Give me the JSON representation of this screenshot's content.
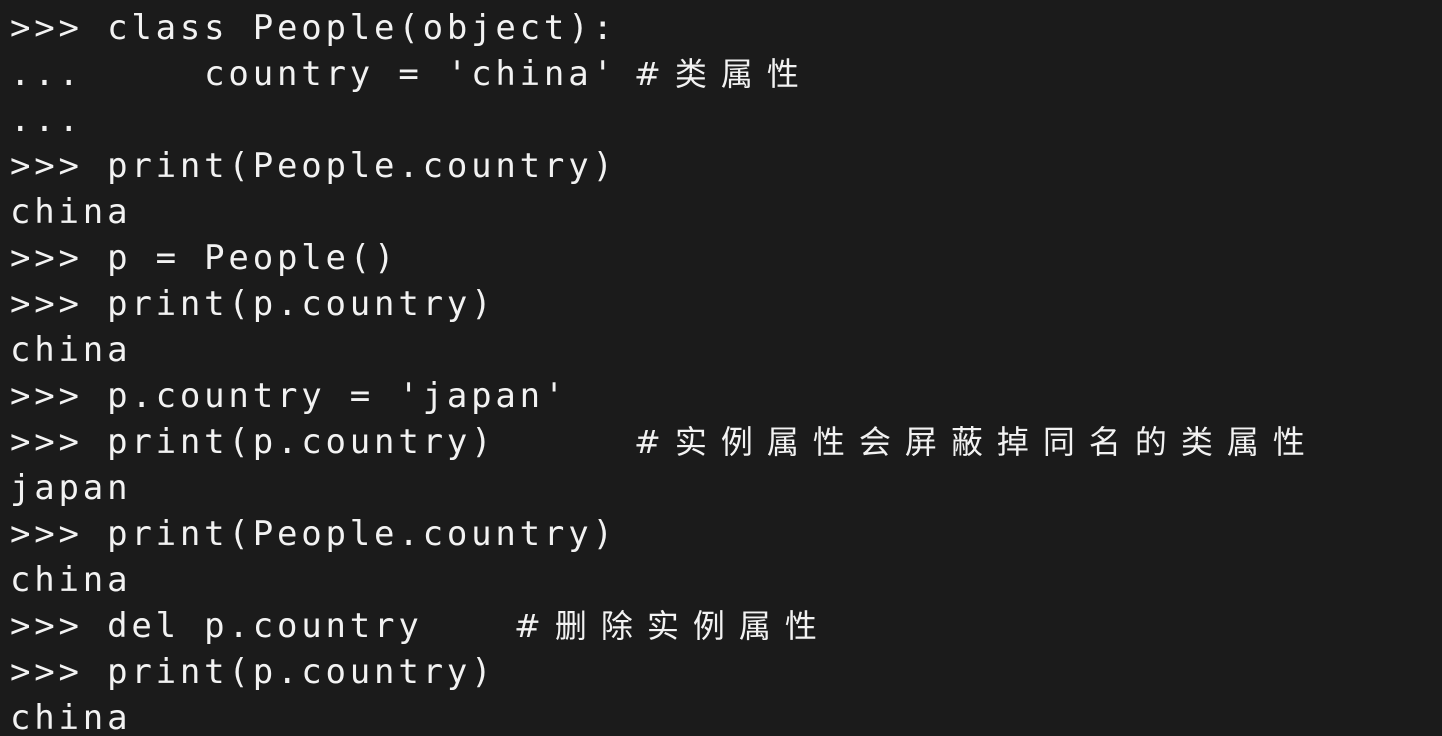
{
  "terminal": {
    "lines": [
      ">>> class People(object):",
      "...     country = 'china'",
      "...",
      ">>> print(People.country)",
      "china",
      ">>> p = People()",
      ">>> print(p.country)",
      "china",
      ">>> p.country = 'japan'",
      ">>> print(p.country)",
      "japan",
      ">>> print(People.country)",
      "china",
      ">>> del p.country",
      ">>> print(p.country)",
      "china"
    ],
    "comments": {
      "line1": "#类属性",
      "line9": "#实例属性会屏蔽掉同名的类属性",
      "line13": "#删除实例属性"
    }
  },
  "colors": {
    "background": "#1b1b1b",
    "text": "#f2f2f2"
  }
}
